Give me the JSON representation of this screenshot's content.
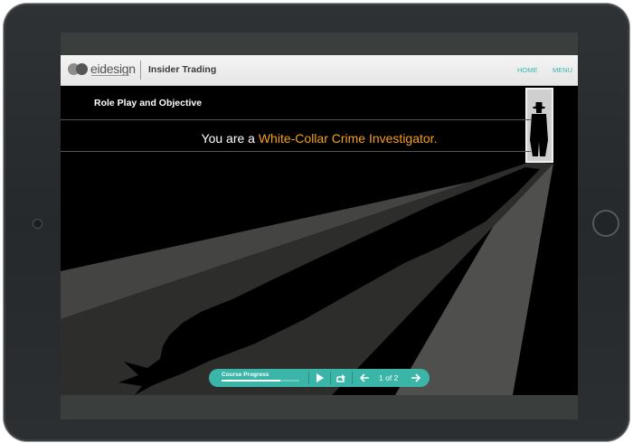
{
  "header": {
    "logo_text": "eidesign",
    "course_title": "Insider Trading",
    "nav": [
      "HOME",
      "MENU"
    ]
  },
  "stage": {
    "section_title": "Role Play and Objective",
    "headline_prefix": "You are a ",
    "headline_highlight": "White-Collar Crime Investigator."
  },
  "player": {
    "progress_label": "Course Progress",
    "progress_fraction": 0.75,
    "page_indicator": "1 of 2"
  },
  "colors": {
    "accent": "#3ab5a8",
    "highlight": "#f5a01e",
    "stage_bg": "#000000"
  },
  "icons": [
    "play-icon",
    "replay-icon",
    "arrow-left-icon",
    "arrow-right-icon"
  ]
}
